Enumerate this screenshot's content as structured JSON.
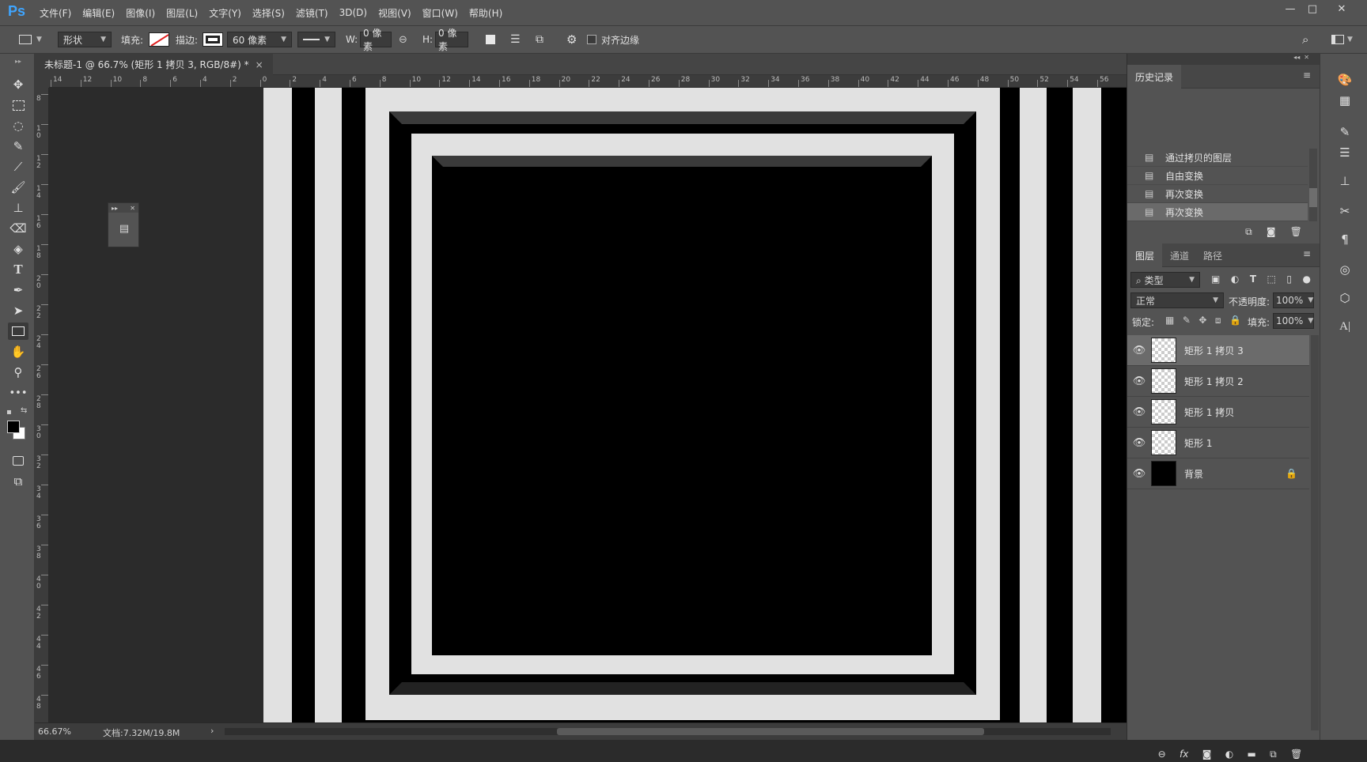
{
  "app": {
    "logo": "Ps",
    "menus": [
      "文件(F)",
      "编辑(E)",
      "图像(I)",
      "图层(L)",
      "文字(Y)",
      "选择(S)",
      "滤镜(T)",
      "3D(D)",
      "视图(V)",
      "窗口(W)",
      "帮助(H)"
    ],
    "window_controls": [
      "—",
      "□",
      "✕"
    ]
  },
  "options": {
    "mode": "形状",
    "fill_label": "填充:",
    "stroke_label": "描边:",
    "stroke_width": "60 像素",
    "w_label": "W:",
    "w_value": "0 像素",
    "h_label": "H:",
    "h_value": "0 像素",
    "align_edges": "对齐边缘"
  },
  "document": {
    "tab_title": "未标题-1 @ 66.7% (矩形 1 拷贝 3, RGB/8#) *",
    "close": "×"
  },
  "rulers": {
    "h_labels": [
      "14",
      "12",
      "10",
      "8",
      "6",
      "4",
      "2",
      "0",
      "2",
      "4",
      "6",
      "8",
      "10",
      "12",
      "14",
      "16",
      "18",
      "20",
      "22",
      "24",
      "26",
      "28",
      "30",
      "32",
      "34",
      "36",
      "38",
      "40",
      "42",
      "44",
      "46",
      "48",
      "50",
      "52",
      "54",
      "56"
    ],
    "v_labels": [
      "8",
      "10",
      "12",
      "14",
      "16",
      "18",
      "20",
      "22",
      "24",
      "26",
      "28",
      "30",
      "32",
      "34",
      "36",
      "38",
      "40",
      "42",
      "44",
      "46",
      "48"
    ]
  },
  "status": {
    "zoom": "66.67%",
    "doc_info": "文档:7.32M/19.8M",
    "arrow": "›"
  },
  "history": {
    "title": "历史记录",
    "items": [
      {
        "label": "通过拷贝的图层",
        "selected": false
      },
      {
        "label": "自由变换",
        "selected": false
      },
      {
        "label": "再次变换",
        "selected": false
      },
      {
        "label": "再次变换",
        "selected": true
      }
    ]
  },
  "layers_panel": {
    "tabs": [
      "图层",
      "通道",
      "路径"
    ],
    "filter": "类型",
    "blend_mode": "正常",
    "opacity_label": "不透明度:",
    "opacity": "100%",
    "lock_label": "锁定:",
    "fill_label": "填充:",
    "fill": "100%",
    "layers": [
      {
        "name": "矩形 1 拷贝 3",
        "selected": true,
        "thumb": "transparent"
      },
      {
        "name": "矩形 1 拷贝 2",
        "selected": false,
        "thumb": "transparent"
      },
      {
        "name": "矩形 1 拷贝",
        "selected": false,
        "thumb": "transparent"
      },
      {
        "name": "矩形 1",
        "selected": false,
        "thumb": "transparent"
      },
      {
        "name": "背景",
        "selected": false,
        "thumb": "black",
        "locked": true
      }
    ],
    "footer_icons": [
      "link-icon",
      "fx-icon",
      "mask-icon",
      "adjustment-icon",
      "folder-icon",
      "new-layer-icon",
      "trash-icon"
    ],
    "fx": "fx"
  },
  "colors": {
    "accent": "#3fa5ff",
    "panel_bg": "#535353",
    "canvas_light": "#e1e1e1",
    "canvas_dark": "#000000"
  }
}
